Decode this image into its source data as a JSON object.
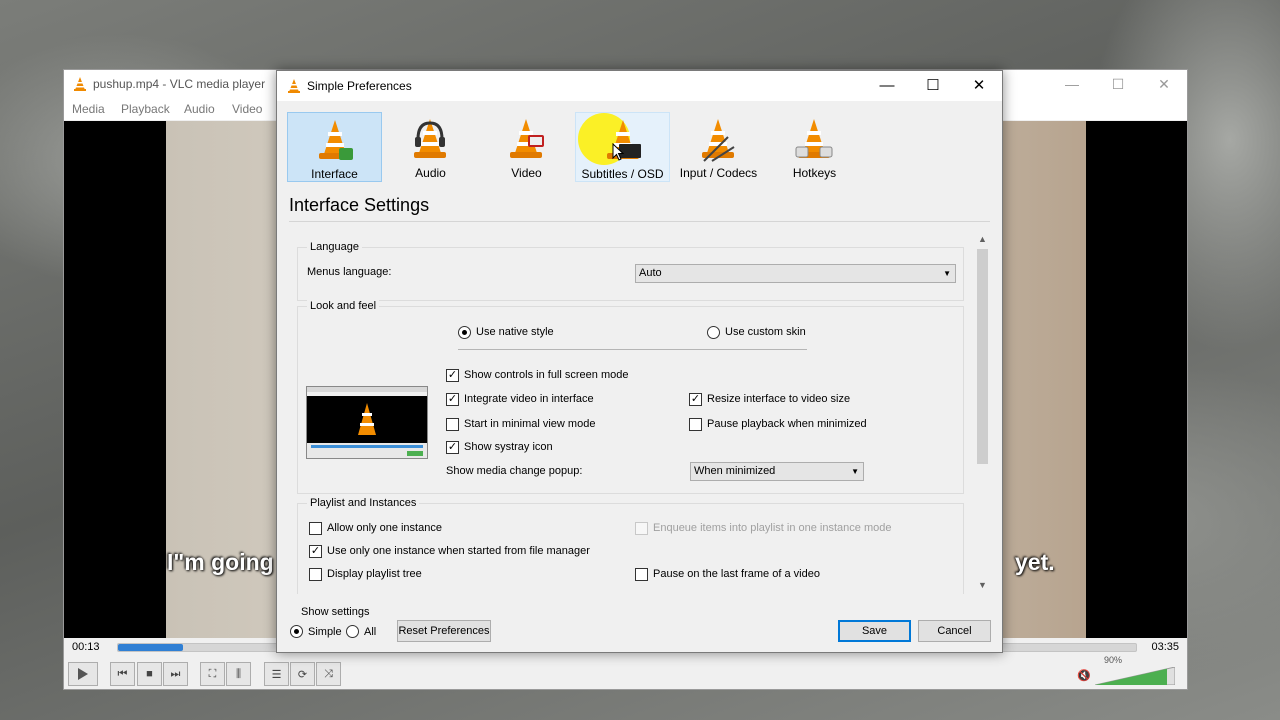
{
  "vlc": {
    "title": "pushup.mp4 - VLC media player",
    "menu": [
      "Media",
      "Playback",
      "Audio",
      "Video"
    ],
    "subtitle_left": "I\"m going",
    "subtitle_right": "yet.",
    "time_elapsed": "00:13",
    "time_total": "03:35",
    "progress_fraction": 0.064,
    "volume_label": "90%",
    "volume_fraction": 0.9
  },
  "dialog": {
    "title": "Simple Preferences",
    "window_buttons": {
      "minimize": "—",
      "maximize": "☐",
      "close": "✕"
    },
    "categories": [
      {
        "label": "Interface",
        "icon": "interface-icon",
        "state": "selected"
      },
      {
        "label": "Audio",
        "icon": "audio-icon",
        "state": "normal"
      },
      {
        "label": "Video",
        "icon": "video-icon",
        "state": "normal"
      },
      {
        "label": "Subtitles / OSD",
        "icon": "subtitles-icon",
        "state": "hovered"
      },
      {
        "label": "Input / Codecs",
        "icon": "input-codecs-icon",
        "state": "normal"
      },
      {
        "label": "Hotkeys",
        "icon": "hotkeys-icon",
        "state": "normal"
      }
    ],
    "heading": "Interface Settings",
    "language": {
      "group_title": "Language",
      "menus_language_label": "Menus language:",
      "menus_language_value": "Auto"
    },
    "look": {
      "group_title": "Look and feel",
      "native_style_label": "Use native style",
      "native_style_checked": true,
      "custom_skin_label": "Use custom skin",
      "custom_skin_checked": false,
      "checks": {
        "full_screen_controls": {
          "label": "Show controls in full screen mode",
          "checked": true
        },
        "integrate_video": {
          "label": "Integrate video in interface",
          "checked": true
        },
        "minimal_view": {
          "label": "Start in minimal view mode",
          "checked": false
        },
        "systray": {
          "label": "Show systray icon",
          "checked": true
        },
        "resize_interface": {
          "label": "Resize interface to video size",
          "checked": true
        },
        "pause_minimized": {
          "label": "Pause playback when minimized",
          "checked": false
        }
      },
      "popup_label": "Show media change popup:",
      "popup_value": "When minimized"
    },
    "playlist": {
      "group_title": "Playlist and Instances",
      "checks": {
        "one_instance": {
          "label": "Allow only one instance",
          "checked": false
        },
        "one_instance_file_manager": {
          "label": "Use only one instance when started from file manager",
          "checked": true
        },
        "playlist_tree": {
          "label": "Display playlist tree",
          "checked": false
        },
        "enqueue_items": {
          "label": "Enqueue items into playlist in one instance mode",
          "checked": false,
          "disabled": true
        },
        "pause_last_frame": {
          "label": "Pause on the last frame of a video",
          "checked": false
        }
      }
    },
    "bottom": {
      "show_settings_label": "Show settings",
      "simple_label": "Simple",
      "all_label": "All",
      "reset_label": "Reset Preferences",
      "save_label": "Save",
      "cancel_label": "Cancel"
    }
  }
}
